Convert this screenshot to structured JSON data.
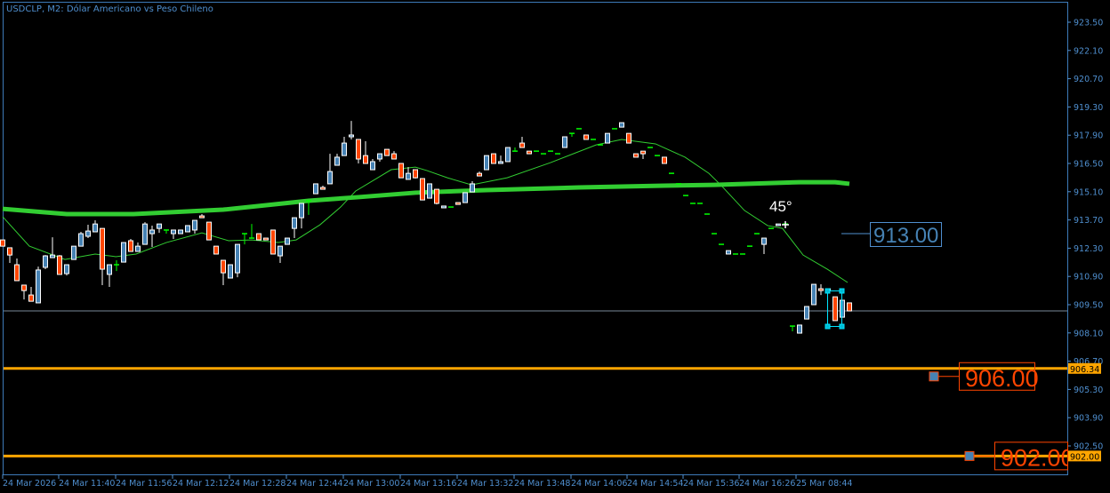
{
  "header": {
    "title": "USDCLP, M2:  Dólar Americano vs Peso Chileno"
  },
  "colors": {
    "background": "#000000",
    "axis": "#4f8fcf",
    "bull_body": "#4682b4",
    "bear_body": "#ff4500",
    "doji": "#00ff00",
    "ma_color": "#32cd32",
    "level_line": "#ffa500",
    "level_label_text": "#ff4500",
    "bid_line": "#778899",
    "selection": "#00e5ff"
  },
  "chart_data": {
    "type": "candlestick",
    "symbol": "USDCLP",
    "timeframe": "M2",
    "ylim": [
      902.0,
      924.6
    ],
    "price_ticks": [
      "923.50",
      "922.10",
      "920.70",
      "919.30",
      "917.90",
      "916.50",
      "915.10",
      "913.70",
      "912.30",
      "910.90",
      "909.50",
      "908.10",
      "906.70",
      "905.30",
      "903.90",
      "902.50"
    ],
    "time_ticks": [
      "24 Mar 2026",
      "24 Mar 11:40",
      "24 Mar 11:56",
      "24 Mar 12:12",
      "24 Mar 12:28",
      "24 Mar 12:44",
      "24 Mar 13:00",
      "24 Mar 13:16",
      "24 Mar 13:32",
      "24 Mar 13:48",
      "24 Mar 14:06",
      "24 Mar 14:54",
      "24 Mar 15:36",
      "24 Mar 16:26",
      "25 Mar 08:44"
    ],
    "candles_ohlc": [
      [
        912.71,
        912.71,
        912.4,
        912.4
      ],
      [
        912.32,
        912.32,
        911.57,
        911.96
      ],
      [
        911.48,
        911.79,
        910.69,
        910.69
      ],
      [
        910.47,
        910.47,
        909.76,
        910.2
      ],
      [
        909.98,
        910.38,
        909.67,
        909.67
      ],
      [
        909.59,
        911.39,
        909.59,
        911.22
      ],
      [
        911.35,
        911.96,
        911.26,
        911.92
      ],
      [
        911.83,
        912.84,
        911.83,
        911.96
      ],
      [
        911.92,
        911.96,
        911.0,
        911.0
      ],
      [
        911.04,
        911.48,
        910.95,
        911.48
      ],
      [
        911.74,
        912.4,
        911.74,
        912.4
      ],
      [
        912.4,
        913.11,
        912.4,
        913.02
      ],
      [
        912.89,
        913.46,
        912.8,
        913.15
      ],
      [
        913.11,
        913.68,
        913.11,
        913.5
      ],
      [
        913.28,
        913.28,
        910.47,
        911.26
      ],
      [
        911.0,
        911.48,
        910.38,
        911.48
      ],
      [
        911.48,
        911.7,
        911.17,
        911.48
      ],
      [
        911.61,
        912.58,
        911.61,
        912.58
      ],
      [
        912.67,
        912.76,
        912.14,
        912.14
      ],
      [
        912.14,
        912.58,
        912.14,
        912.4
      ],
      [
        912.49,
        913.59,
        912.49,
        913.5
      ],
      [
        913.02,
        913.42,
        912.36,
        913.2
      ],
      [
        913.28,
        913.5,
        913.06,
        913.5
      ],
      [
        913.2,
        913.2,
        913.02,
        913.2
      ],
      [
        913.02,
        913.2,
        912.76,
        913.2
      ],
      [
        913.02,
        913.2,
        913.02,
        913.2
      ],
      [
        913.11,
        913.42,
        913.11,
        913.42
      ],
      [
        913.2,
        913.68,
        913.02,
        913.68
      ],
      [
        913.9,
        913.99,
        913.81,
        913.81
      ],
      [
        913.59,
        913.59,
        912.71,
        912.71
      ],
      [
        912.4,
        912.4,
        912.01,
        912.01
      ],
      [
        911.7,
        911.7,
        910.47,
        911.08
      ],
      [
        910.82,
        911.48,
        910.82,
        911.48
      ],
      [
        911.08,
        912.49,
        910.86,
        912.49
      ],
      [
        913.02,
        913.02,
        912.49,
        913.02
      ],
      [
        912.8,
        913.5,
        912.8,
        912.8
      ],
      [
        913.02,
        913.02,
        912.71,
        912.71
      ],
      [
        912.8,
        912.8,
        912.71,
        912.71
      ],
      [
        913.2,
        913.2,
        912.01,
        912.01
      ],
      [
        911.92,
        912.4,
        911.57,
        912.4
      ],
      [
        912.49,
        912.8,
        912.49,
        912.8
      ],
      [
        913.28,
        913.81,
        912.8,
        913.81
      ],
      [
        913.81,
        914.52,
        913.28,
        914.52
      ],
      [
        914.65,
        914.65,
        913.95,
        914.65
      ],
      [
        915.0,
        915.49,
        915.0,
        915.49
      ],
      [
        915.31,
        915.4,
        915.22,
        915.22
      ],
      [
        915.49,
        916.98,
        915.49,
        916.1
      ],
      [
        916.41,
        916.98,
        916.41,
        916.81
      ],
      [
        916.89,
        917.82,
        916.89,
        917.51
      ],
      [
        917.82,
        918.61,
        917.69,
        917.91
      ],
      [
        917.69,
        917.69,
        916.5,
        916.72
      ],
      [
        916.89,
        917.6,
        916.5,
        916.5
      ],
      [
        916.19,
        916.72,
        916.19,
        916.59
      ],
      [
        916.72,
        916.98,
        916.59,
        916.98
      ],
      [
        917.2,
        917.2,
        916.89,
        916.89
      ],
      [
        916.98,
        917.11,
        916.72,
        916.72
      ],
      [
        916.5,
        916.5,
        915.79,
        915.79
      ],
      [
        915.71,
        916.32,
        915.71,
        916.01
      ],
      [
        916.19,
        916.19,
        915.75,
        915.79
      ],
      [
        915.75,
        915.75,
        914.69,
        914.69
      ],
      [
        914.78,
        915.49,
        914.78,
        915.49
      ],
      [
        915.22,
        915.22,
        914.47,
        914.52
      ],
      [
        914.3,
        914.39,
        914.3,
        914.39
      ],
      [
        914.34,
        914.34,
        914.34,
        914.34
      ],
      [
        914.56,
        914.56,
        914.47,
        914.47
      ],
      [
        914.56,
        915.05,
        914.56,
        915.05
      ],
      [
        915.09,
        915.62,
        915.09,
        915.49
      ],
      [
        916.01,
        916.1,
        915.88,
        915.88
      ],
      [
        916.19,
        916.89,
        916.19,
        916.89
      ],
      [
        916.98,
        916.98,
        916.5,
        916.5
      ],
      [
        916.5,
        916.89,
        916.5,
        916.59
      ],
      [
        916.59,
        917.29,
        916.59,
        917.29
      ],
      [
        917.11,
        917.29,
        917.11,
        917.11
      ],
      [
        917.51,
        917.82,
        917.29,
        917.29
      ],
      [
        917.11,
        917.11,
        916.98,
        916.98
      ],
      [
        917.11,
        917.11,
        917.11,
        917.11
      ],
      [
        916.98,
        916.98,
        916.98,
        916.98
      ],
      [
        917.11,
        917.11,
        917.11,
        917.11
      ],
      [
        916.98,
        916.98,
        916.98,
        916.98
      ],
      [
        917.29,
        917.82,
        917.29,
        917.82
      ],
      [
        917.99,
        917.99,
        917.82,
        917.99
      ],
      [
        918.22,
        918.22,
        918.22,
        918.22
      ],
      [
        917.91,
        917.91,
        917.69,
        917.69
      ],
      [
        917.69,
        917.69,
        917.69,
        917.69
      ],
      [
        917.42,
        917.42,
        917.42,
        917.42
      ],
      [
        917.51,
        917.99,
        917.51,
        917.99
      ],
      [
        918.22,
        918.22,
        918.22,
        918.22
      ],
      [
        918.3,
        918.52,
        918.3,
        918.52
      ],
      [
        917.99,
        917.99,
        917.51,
        917.51
      ],
      [
        916.98,
        916.98,
        916.81,
        916.81
      ],
      [
        917.11,
        917.11,
        916.72,
        916.98
      ],
      [
        917.29,
        917.29,
        917.29,
        917.29
      ],
      [
        916.89,
        916.89,
        916.89,
        916.89
      ],
      [
        916.81,
        916.81,
        916.5,
        916.5
      ],
      [
        916.01,
        916.01,
        916.01,
        916.01
      ],
      [
        915.49,
        915.49,
        915.49,
        915.49
      ],
      [
        914.91,
        914.91,
        914.91,
        914.91
      ],
      [
        914.52,
        914.52,
        914.52,
        914.52
      ],
      [
        914.52,
        914.52,
        914.52,
        914.52
      ],
      [
        913.99,
        913.99,
        913.99,
        913.99
      ],
      [
        913.02,
        913.02,
        913.02,
        913.02
      ],
      [
        912.49,
        912.49,
        912.49,
        912.49
      ],
      [
        912.01,
        912.18,
        912.01,
        912.18
      ],
      [
        912.01,
        912.01,
        912.01,
        912.01
      ],
      [
        912.01,
        912.01,
        912.01,
        912.01
      ],
      [
        912.4,
        912.4,
        912.4,
        912.4
      ],
      [
        913.02,
        913.02,
        913.02,
        913.02
      ],
      [
        912.49,
        912.8,
        912.01,
        912.8
      ],
      [
        913.28,
        913.28,
        913.28,
        913.28
      ],
      [
        913.42,
        913.5,
        913.42,
        913.5
      ],
      [
        913.5,
        913.59,
        913.37,
        913.5
      ],
      [
        908.44,
        908.44,
        908.18,
        908.44
      ],
      [
        908.09,
        908.49,
        908.09,
        908.49
      ],
      [
        908.79,
        909.41,
        908.79,
        909.41
      ],
      [
        909.5,
        910.51,
        909.5,
        910.51
      ],
      [
        910.29,
        910.51,
        909.98,
        910.2
      ],
      [
        910.29,
        910.29,
        910.2,
        910.2
      ],
      [
        909.89,
        909.89,
        908.71,
        908.71
      ],
      [
        908.88,
        909.72,
        908.88,
        909.72
      ],
      [
        909.59,
        909.59,
        909.19,
        909.19
      ]
    ],
    "ma_fast": [
      [
        0,
        913.86
      ],
      [
        3.75,
        912.4
      ],
      [
        8.75,
        911.74
      ],
      [
        13,
        912.01
      ],
      [
        15.9,
        911.88
      ],
      [
        18.75,
        912.01
      ],
      [
        23,
        912.58
      ],
      [
        28,
        913.06
      ],
      [
        31.75,
        912.67
      ],
      [
        35,
        912.71
      ],
      [
        38.75,
        912.58
      ],
      [
        41.25,
        912.71
      ],
      [
        44.6,
        913.46
      ],
      [
        47.5,
        914.34
      ],
      [
        49.6,
        915.13
      ],
      [
        54.6,
        916.19
      ],
      [
        58,
        916.32
      ],
      [
        59.6,
        916.15
      ],
      [
        62.5,
        915.79
      ],
      [
        65.9,
        915.44
      ],
      [
        70.9,
        915.79
      ],
      [
        77,
        916.54
      ],
      [
        83.4,
        917.42
      ],
      [
        87,
        917.69
      ],
      [
        91.75,
        917.47
      ],
      [
        95.9,
        916.81
      ],
      [
        99.25,
        916.01
      ],
      [
        100.9,
        915.44
      ],
      [
        104.25,
        914.17
      ],
      [
        107.5,
        913.42
      ],
      [
        109.6,
        913.28
      ],
      [
        112.5,
        911.96
      ],
      [
        115.9,
        911.26
      ],
      [
        118.75,
        910.6
      ]
    ],
    "ma_slow": [
      [
        0,
        914.25
      ],
      [
        9,
        913.99
      ],
      [
        18.4,
        913.99
      ],
      [
        31,
        914.21
      ],
      [
        43,
        914.65
      ],
      [
        50,
        914.83
      ],
      [
        58,
        915.05
      ],
      [
        68,
        915.18
      ],
      [
        81,
        915.31
      ],
      [
        93,
        915.4
      ],
      [
        100,
        915.44
      ],
      [
        112,
        915.57
      ],
      [
        117,
        915.57
      ],
      [
        119,
        915.49
      ]
    ],
    "bid": 909.19,
    "levels": [
      {
        "price": 906.34,
        "axis_label": "906.34",
        "text": "906.00"
      },
      {
        "price": 902.0,
        "axis_label": "902.00",
        "text": "902.00"
      }
    ],
    "price_label": {
      "price": 913.0,
      "text": "913.00"
    },
    "angle_label": "45°"
  }
}
